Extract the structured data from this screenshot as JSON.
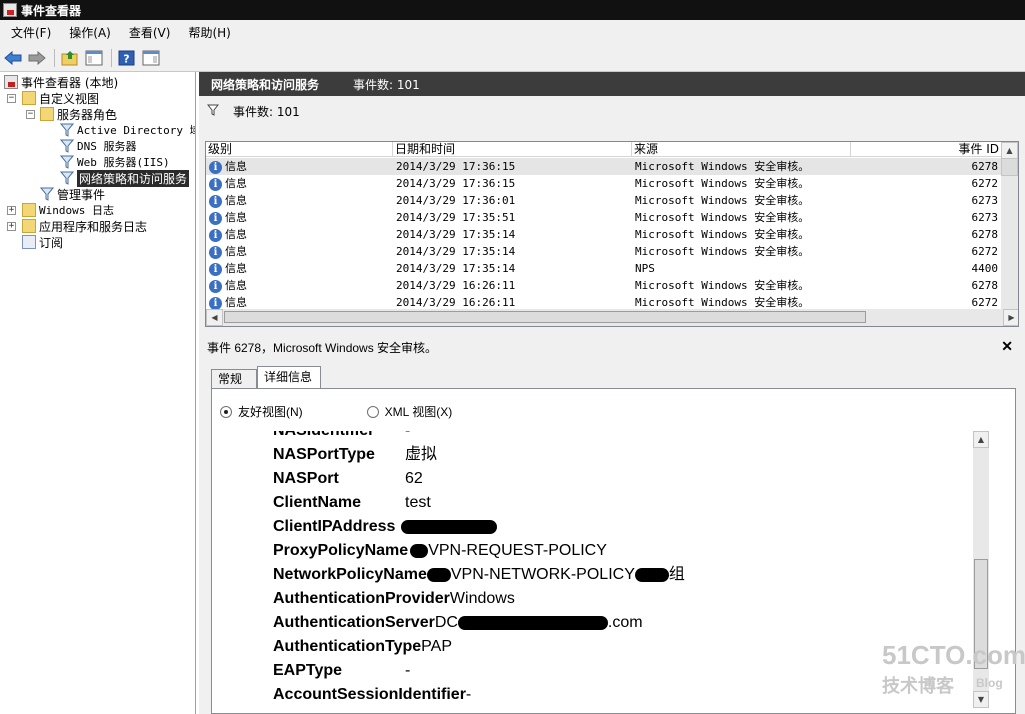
{
  "window": {
    "title": "事件查看器"
  },
  "menu": [
    "文件(F)",
    "操作(A)",
    "查看(V)",
    "帮助(H)"
  ],
  "tree": {
    "root": "事件查看器 (本地)",
    "custom_views": "自定义视图",
    "server_roles": "服务器角色",
    "roles": [
      "Active Directory 域",
      "DNS 服务器",
      "Web 服务器(IIS)",
      "网络策略和访问服务"
    ],
    "admin_events": "管理事件",
    "windows_logs": "Windows 日志",
    "app_logs": "应用程序和服务日志",
    "subscriptions": "订阅"
  },
  "pane": {
    "title": "网络策略和访问服务",
    "event_count": "事件数: 101"
  },
  "filter": {
    "label": "事件数: 101"
  },
  "columns": [
    "级别",
    "日期和时间",
    "来源",
    "事件 ID"
  ],
  "rows": [
    {
      "level": "信息",
      "datetime": "2014/3/29 17:36:15",
      "source": "Microsoft Windows 安全审核。",
      "id": "6278"
    },
    {
      "level": "信息",
      "datetime": "2014/3/29 17:36:15",
      "source": "Microsoft Windows 安全审核。",
      "id": "6272"
    },
    {
      "level": "信息",
      "datetime": "2014/3/29 17:36:01",
      "source": "Microsoft Windows 安全审核。",
      "id": "6273"
    },
    {
      "level": "信息",
      "datetime": "2014/3/29 17:35:51",
      "source": "Microsoft Windows 安全审核。",
      "id": "6273"
    },
    {
      "level": "信息",
      "datetime": "2014/3/29 17:35:14",
      "source": "Microsoft Windows 安全审核。",
      "id": "6278"
    },
    {
      "level": "信息",
      "datetime": "2014/3/29 17:35:14",
      "source": "Microsoft Windows 安全审核。",
      "id": "6272"
    },
    {
      "level": "信息",
      "datetime": "2014/3/29 17:35:14",
      "source": "NPS",
      "id": "4400"
    },
    {
      "level": "信息",
      "datetime": "2014/3/29 16:26:11",
      "source": "Microsoft Windows 安全审核。",
      "id": "6278"
    },
    {
      "level": "信息",
      "datetime": "2014/3/29 16:26:11",
      "source": "Microsoft Windows 安全审核。",
      "id": "6272"
    }
  ],
  "detail": {
    "title": "事件 6278，Microsoft Windows 安全审核。",
    "tabs": [
      "常规",
      "详细信息"
    ],
    "friendly_view": "友好视图(N)",
    "xml_view": "XML 视图(X)",
    "fields": [
      {
        "k": "NASIdentifier",
        "v": "-"
      },
      {
        "k": "NASPortType",
        "v": "虚拟"
      },
      {
        "k": "NASPort",
        "v": "62"
      },
      {
        "k": "ClientName",
        "v": "test"
      },
      {
        "k": "ClientIPAddress",
        "v": ""
      },
      {
        "k": "ProxyPolicyName",
        "v": "VPN-REQUEST-POLICY"
      },
      {
        "k": "NetworkPolicyName",
        "v": "VPN-NETWORK-POLICY",
        "v2": "组"
      },
      {
        "k": "AuthenticationProvider",
        "v": "Windows"
      },
      {
        "k": "AuthenticationServer",
        "v": "DC",
        "v2": ".com"
      },
      {
        "k": "AuthenticationType",
        "v": "PAP"
      },
      {
        "k": "EAPType",
        "v": "-"
      },
      {
        "k": "AccountSessionIdentifier",
        "v": "-"
      }
    ]
  },
  "watermark": {
    "logo": "51CTO.com",
    "sub": "技术博客",
    "blog": "Blog"
  }
}
